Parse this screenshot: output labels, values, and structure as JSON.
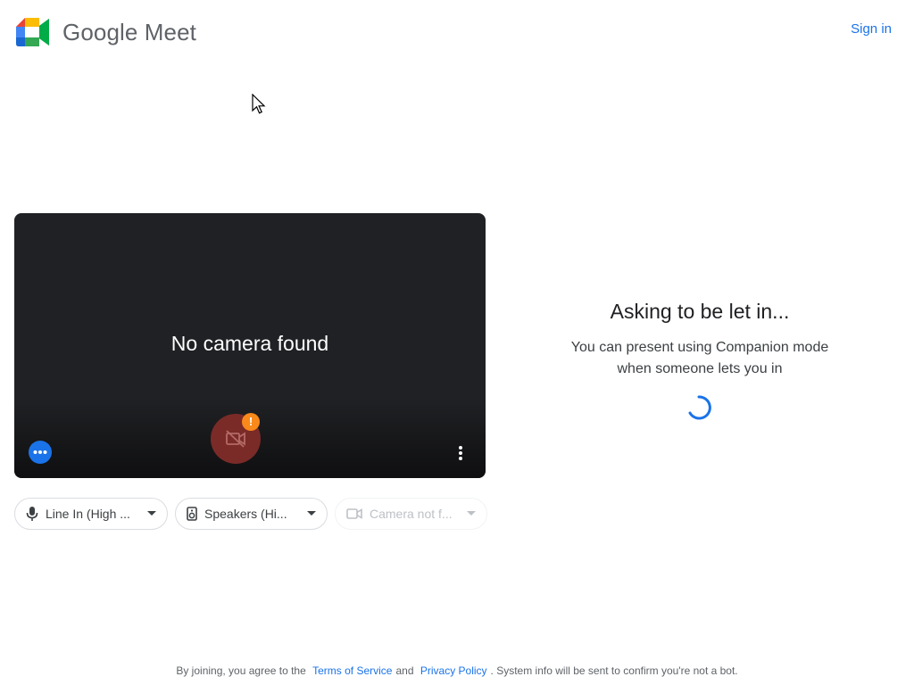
{
  "header": {
    "brand_name": "Google Meet",
    "sign_in": "Sign in"
  },
  "preview": {
    "message": "No camera found",
    "warning_badge": "!",
    "icons": {
      "effects": "more-horizontal-icon",
      "camera": "camera-off-icon",
      "more": "more-vert-icon"
    }
  },
  "devices": {
    "microphone": "Line In (High ...",
    "speaker": "Speakers (Hi...",
    "camera": "Camera not f..."
  },
  "status": {
    "title": "Asking to be let in...",
    "line1": "You can present using Companion mode",
    "line2": "when someone lets you in"
  },
  "footer": {
    "prefix": "By joining, you agree to the",
    "terms": "Terms of Service",
    "and": "and",
    "privacy": "Privacy Policy",
    "suffix": ". System info will be sent to confirm you're not a bot."
  },
  "colors": {
    "accent": "#1a73e8",
    "tile_bg": "#202124",
    "camera_off": "#7a2b28",
    "warning": "#f9891a"
  }
}
